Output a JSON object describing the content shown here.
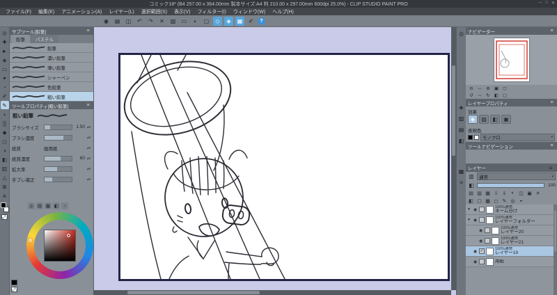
{
  "titlebar": {
    "title": "コミック18* (B4 257.00 x 364.00mm 製本サイズ:A4 判 210.00 x 297.00mm 600dpi 25.0%) - CLIP STUDIO PAINT PRO"
  },
  "window_controls": {
    "minimize": "─",
    "maximize": "□",
    "close": "✕"
  },
  "menubar": {
    "items": [
      "ファイル(F)",
      "編集(E)",
      "アニメーション(A)",
      "レイヤー(L)",
      "選択範囲(S)",
      "表示(V)",
      "フィルター(I)",
      "ウィンドウ(W)",
      "ヘルプ(H)"
    ]
  },
  "toolbar": {
    "icons": [
      {
        "name": "clip-studio-home",
        "glyph": "◉"
      },
      {
        "name": "new-file",
        "glyph": "▤"
      },
      {
        "name": "save-file",
        "glyph": "◫"
      },
      {
        "name": "undo",
        "glyph": "↶"
      },
      {
        "name": "redo",
        "glyph": "↷"
      },
      {
        "name": "clear",
        "glyph": "✕"
      },
      {
        "name": "fill",
        "glyph": "▧"
      },
      {
        "name": "deselect",
        "glyph": "▭"
      },
      {
        "name": "invert-selection",
        "glyph": "◐"
      },
      {
        "name": "selection-border",
        "glyph": "▢"
      },
      {
        "name": "snap-ruler",
        "glyph": "◇",
        "active": true
      },
      {
        "name": "snap-special-ruler",
        "glyph": "◈",
        "active": true
      },
      {
        "name": "snap-grid",
        "glyph": "▦",
        "active": true
      },
      {
        "name": "pen-pressure-settings",
        "glyph": "✐"
      },
      {
        "name": "help",
        "glyph": "?",
        "round": true
      }
    ]
  },
  "toolstrip": {
    "tools": [
      {
        "name": "zoom-tool",
        "glyph": "◎"
      },
      {
        "name": "move-tool",
        "glyph": "✚"
      },
      {
        "name": "operation-tool",
        "glyph": "►"
      },
      {
        "name": "layer-move-tool",
        "glyph": "◈"
      },
      {
        "name": "selection-tool",
        "glyph": "▭"
      },
      {
        "name": "auto-select-tool",
        "glyph": "✦"
      },
      {
        "name": "eyedropper-tool",
        "glyph": "◔"
      },
      {
        "name": "pen-tool",
        "glyph": "✐"
      },
      {
        "name": "pencil-tool",
        "glyph": "✎",
        "selected": true
      },
      {
        "name": "brush-tool",
        "glyph": "◖"
      },
      {
        "name": "airbrush-tool",
        "glyph": "▒"
      },
      {
        "name": "decoration-tool",
        "glyph": "◆"
      },
      {
        "name": "eraser-tool",
        "glyph": "◻"
      },
      {
        "name": "blend-tool",
        "glyph": "◑"
      },
      {
        "name": "fill-tool",
        "glyph": "◧"
      },
      {
        "name": "gradient-tool",
        "glyph": "▥"
      },
      {
        "name": "figure-tool",
        "glyph": "△"
      },
      {
        "name": "frame-border-tool",
        "glyph": "⊞"
      },
      {
        "name": "text-tool",
        "glyph": "A"
      }
    ]
  },
  "subtool": {
    "panel_title": "サブツール[鉛筆]",
    "tabs": [
      {
        "label": "鉛筆",
        "active": true
      },
      {
        "label": "パステル",
        "active": false
      }
    ],
    "brushes": [
      {
        "name": "鉛筆"
      },
      {
        "name": "濃い鉛筆"
      },
      {
        "name": "薄い鉛筆"
      },
      {
        "name": "シャーペン"
      },
      {
        "name": "色鉛筆"
      },
      {
        "name": "粗い鉛筆",
        "selected": true
      }
    ]
  },
  "tool_property": {
    "panel_title": "ツールプロパティ[粗い鉛筆]",
    "tool_name": "粗い鉛筆",
    "rows": [
      {
        "label": "ブラシサイズ",
        "value": "1.50",
        "fill": 20
      },
      {
        "label": "ブラシ濃度",
        "value": "",
        "fill": 68
      },
      {
        "label": "紙質",
        "value": "画用紙",
        "textonly": true
      },
      {
        "label": "紙質濃度",
        "value": "60",
        "fill": 60
      },
      {
        "label": "拡大率",
        "value": "",
        "fill": 45
      },
      {
        "label": "手ブレ補正",
        "value": "",
        "fill": 28
      }
    ]
  },
  "color_panel": {
    "current_color": "#c62b1e",
    "tabs": [
      {
        "name": "color-wheel-tab",
        "glyph": "◎"
      },
      {
        "name": "color-slider-tab",
        "glyph": "▤"
      },
      {
        "name": "color-set-tab",
        "glyph": "▦"
      },
      {
        "name": "color-mixing-tab",
        "glyph": "◧"
      },
      {
        "name": "color-history-tab",
        "glyph": "◔"
      }
    ]
  },
  "dock": {
    "icons_top": [
      {
        "name": "quick-access-dock",
        "glyph": "◎"
      }
    ],
    "icons_mid": [
      {
        "name": "layer-property-dock",
        "glyph": "◈"
      },
      {
        "name": "tone-dock",
        "glyph": "▨"
      },
      {
        "name": "history-dock",
        "glyph": "▤"
      },
      {
        "name": "material-dock",
        "glyph": "◧"
      }
    ],
    "icons_bottom": [
      {
        "name": "layer-dock",
        "glyph": "▦"
      },
      {
        "name": "layer-search-dock",
        "glyph": "≡"
      }
    ]
  },
  "navigator": {
    "panel_title": "ナビゲーター",
    "zoom_icons": [
      {
        "name": "zoom-out",
        "glyph": "⊖"
      },
      {
        "name": "zoom-slider",
        "glyph": "─"
      },
      {
        "name": "zoom-in",
        "glyph": "⊕"
      },
      {
        "name": "fit-to-screen",
        "glyph": "▣"
      },
      {
        "name": "actual-size",
        "glyph": "◻"
      }
    ],
    "rotate_icons": [
      {
        "name": "rotate-left",
        "glyph": "↺"
      },
      {
        "name": "rotate-slider",
        "glyph": "─"
      },
      {
        "name": "rotate-right",
        "glyph": "↻"
      },
      {
        "name": "flip-horizontal",
        "glyph": "◧"
      },
      {
        "name": "reset-display",
        "glyph": "▢"
      }
    ]
  },
  "layer_property": {
    "panel_title": "レイヤープロパティ",
    "effect_label": "効果",
    "effect_icons": [
      {
        "name": "border-effect",
        "glyph": "◈",
        "active": true
      },
      {
        "name": "tone-effect",
        "glyph": "▨"
      },
      {
        "name": "layer-color-effect",
        "glyph": "◧"
      },
      {
        "name": "extract-line-effect",
        "glyph": "▣"
      }
    ],
    "expression_label": "表現色",
    "expression_value": "モノクロ"
  },
  "tool_navigation": {
    "panel_title": "ツールナビゲーション"
  },
  "layers": {
    "panel_title": "レイヤー",
    "blend_mode": "通常",
    "opacity": "100",
    "toolbar_icons": [
      {
        "name": "new-raster-layer",
        "glyph": "▤"
      },
      {
        "name": "new-vector-layer",
        "glyph": "▥"
      },
      {
        "name": "new-layer-folder",
        "glyph": "▦"
      },
      {
        "name": "transfer-to-lower-layer",
        "glyph": "⇩"
      },
      {
        "name": "combine-with-lower-layer",
        "glyph": "⇓"
      },
      {
        "name": "layer-mask",
        "glyph": "◐"
      },
      {
        "name": "apply-mask",
        "glyph": "◫"
      },
      {
        "name": "two-pane-view",
        "glyph": "▣"
      },
      {
        "name": "delete-layer",
        "glyph": "✕"
      }
    ],
    "toolbar_icons2": [
      {
        "name": "clip-to-layer-below",
        "glyph": "◧"
      },
      {
        "name": "lock-layer",
        "glyph": "▢"
      },
      {
        "name": "lock-transparent-pixels",
        "glyph": "▩"
      },
      {
        "name": "enable-mask",
        "glyph": "◻"
      },
      {
        "name": "set-as-draft-layer",
        "glyph": "✎"
      },
      {
        "name": "reference-layer",
        "glyph": "◎"
      },
      {
        "name": "palette-color",
        "glyph": "◒"
      }
    ],
    "items": [
      {
        "type": "folder",
        "expanded": true,
        "blend": "100%通常",
        "name": "ネーム分け",
        "indent": 0
      },
      {
        "type": "folder",
        "expanded": true,
        "blend": "100%通常",
        "name": "レイヤーフォルダー",
        "indent": 0
      },
      {
        "type": "layer",
        "blend": "100%通常",
        "name": "レイヤー20",
        "indent": 1
      },
      {
        "type": "layer",
        "blend": "100%通常",
        "name": "レイヤー21",
        "indent": 1
      },
      {
        "type": "layer",
        "blend": "100%通常",
        "name": "レイヤー19",
        "indent": 0,
        "selected": true
      },
      {
        "type": "paper",
        "blend": "",
        "name": "用紙",
        "indent": 0
      }
    ]
  },
  "ui": {
    "menu_glyph": "≡",
    "dropdown_glyph": "▾",
    "check_glyph": "✓",
    "eye_glyph": "◉",
    "blend_icon_glyph": "▥",
    "opacity_icon_glyph": "◧"
  }
}
